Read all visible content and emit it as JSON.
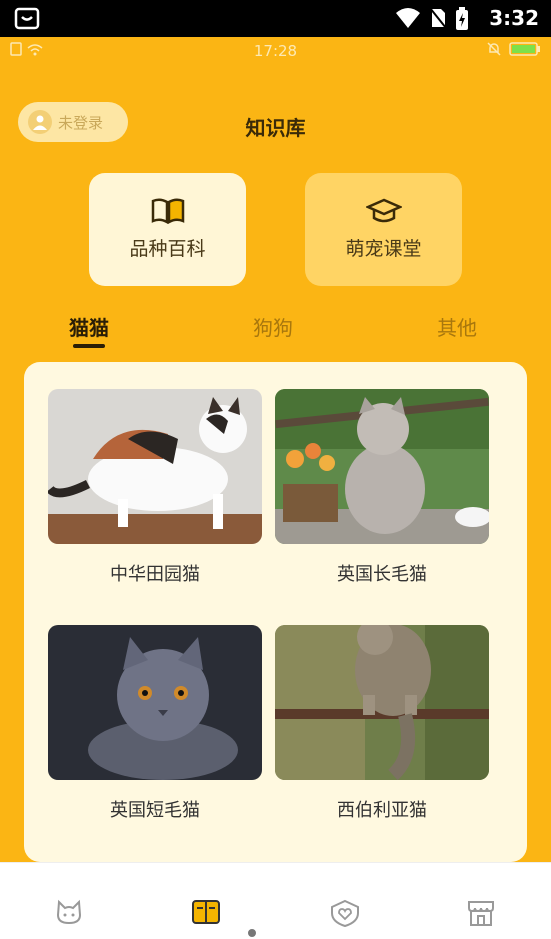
{
  "system_status": {
    "time": "3:32"
  },
  "app_status": {
    "time": "17:28"
  },
  "header": {
    "login_label": "未登录",
    "title": "知识库"
  },
  "cards": [
    {
      "label": "品种百科",
      "icon": "book-icon"
    },
    {
      "label": "萌宠课堂",
      "icon": "graduation-cap-icon"
    }
  ],
  "tabs": [
    {
      "label": "猫猫",
      "active": true
    },
    {
      "label": "狗狗",
      "active": false
    },
    {
      "label": "其他",
      "active": false
    }
  ],
  "breeds": [
    {
      "name": "中华田园猫"
    },
    {
      "name": "英国长毛猫"
    },
    {
      "name": "英国短毛猫"
    },
    {
      "name": "西伯利亚猫"
    }
  ],
  "nav": [
    {
      "icon": "cat-face-icon",
      "label": "",
      "active": false
    },
    {
      "icon": "knowledge-book-icon",
      "label": "",
      "active": true
    },
    {
      "icon": "heart-shield-icon",
      "label": "",
      "active": false
    },
    {
      "icon": "store-icon",
      "label": "",
      "active": false
    }
  ],
  "colors": {
    "background": "#FBB514",
    "panel": "#FFF9E0",
    "accent_dark": "#2b1e06"
  }
}
